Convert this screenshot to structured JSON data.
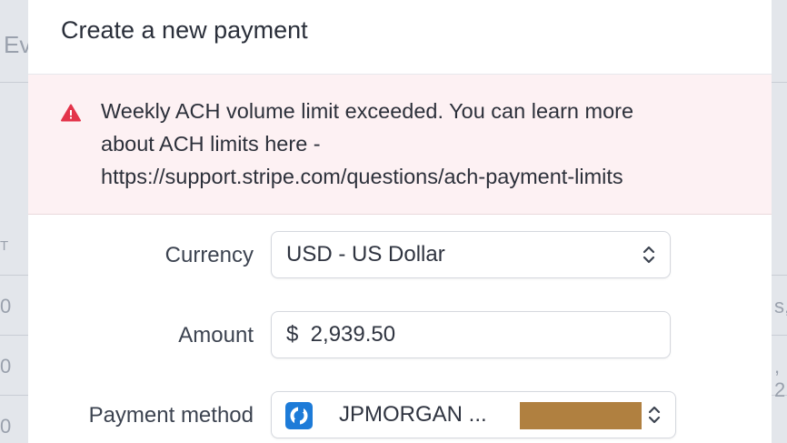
{
  "modal": {
    "title": "Create a new payment"
  },
  "alert": {
    "icon": "warning-triangle-icon",
    "color": "#e3344a",
    "lines": [
      "Weekly ACH volume limit exceeded. You can learn more",
      "about ACH limits here -",
      "https://support.stripe.com/questions/ach-payment-limits"
    ]
  },
  "form": {
    "currency": {
      "label": "Currency",
      "value": "USD - US Dollar"
    },
    "amount": {
      "label": "Amount",
      "value": "$  2,939.50"
    },
    "payment_method": {
      "label": "Payment method",
      "value": "JPMORGAN ..."
    }
  },
  "background": {
    "texts": [
      "Ev",
      "T",
      "0",
      "0",
      "0",
      "s,",
      ", 2"
    ]
  }
}
